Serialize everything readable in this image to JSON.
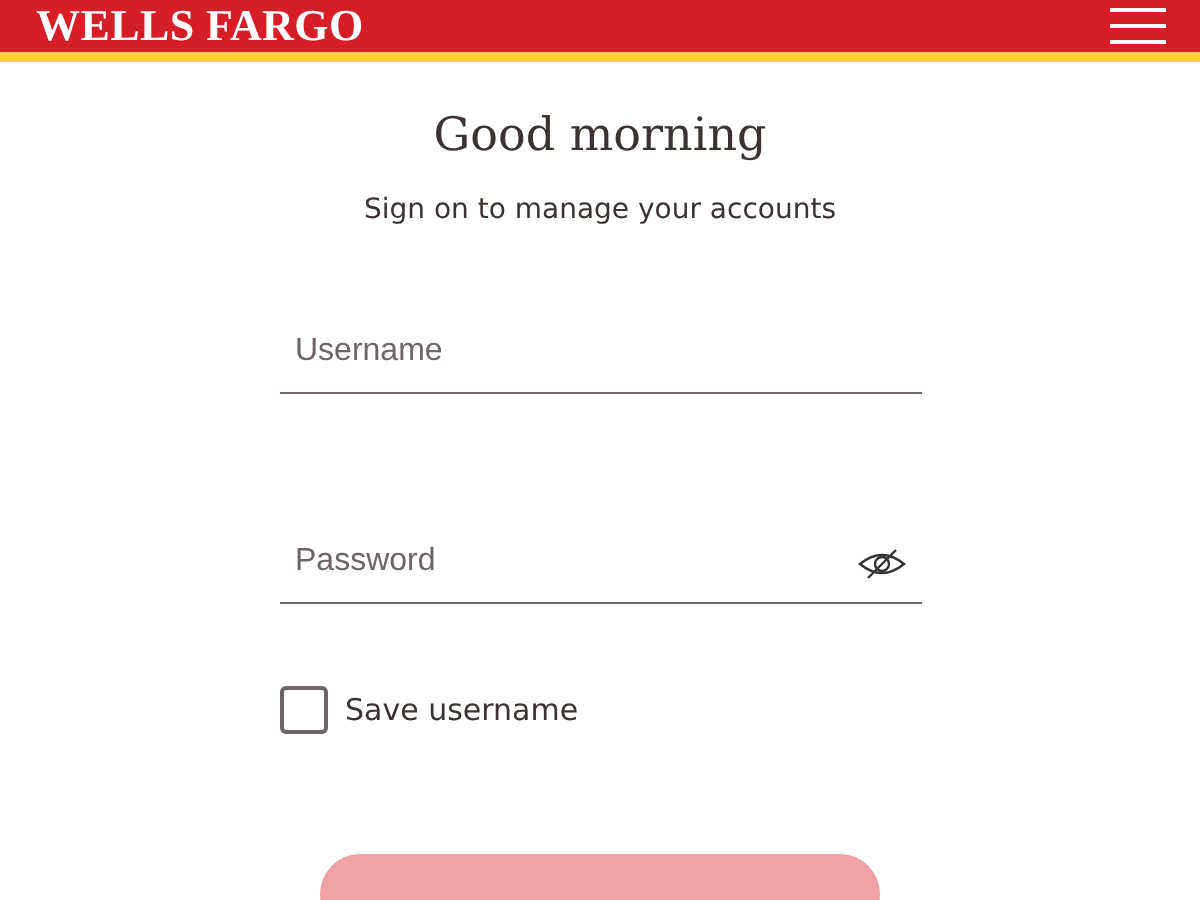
{
  "header": {
    "logo": "WELLS FARGO"
  },
  "greeting": "Good morning",
  "subtitle": "Sign on to manage your accounts",
  "fields": [
    {
      "kind": "text",
      "placeholder": "Username"
    },
    {
      "kind": "password",
      "placeholder": "Password"
    }
  ],
  "save_username": {
    "label": "Save username",
    "checked": false
  }
}
